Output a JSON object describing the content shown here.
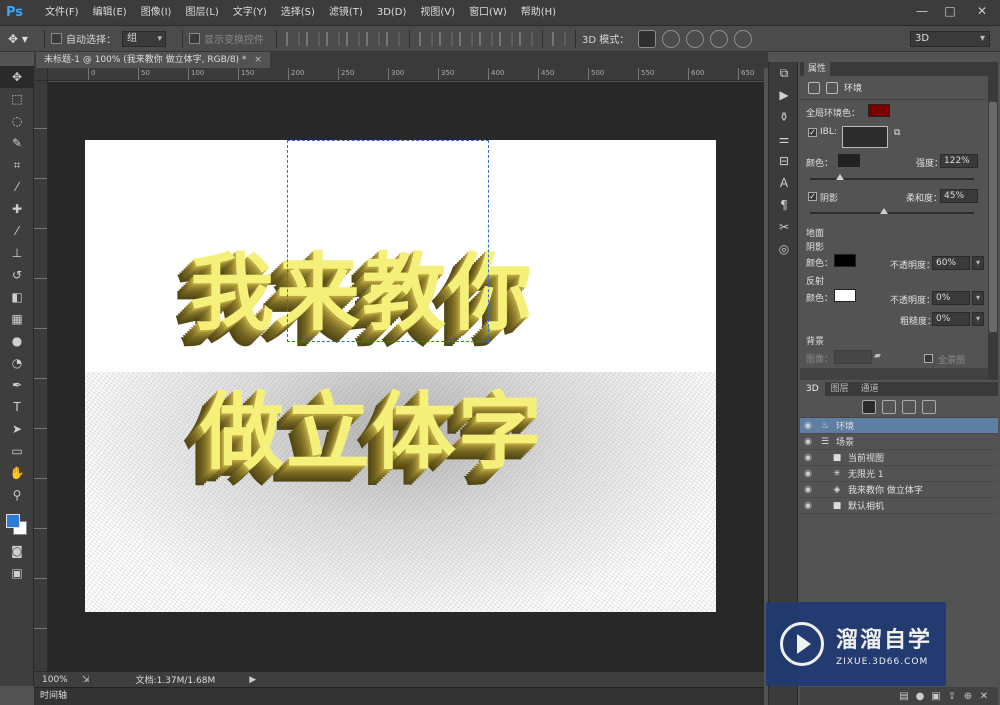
{
  "app": {
    "logo": "Ps",
    "menu": [
      "文件(F)",
      "编辑(E)",
      "图像(I)",
      "图层(L)",
      "文字(Y)",
      "选择(S)",
      "滤镜(T)",
      "3D(D)",
      "视图(V)",
      "窗口(W)",
      "帮助(H)"
    ],
    "window_controls": [
      "—",
      "□",
      "✕"
    ]
  },
  "options_bar": {
    "auto_select_label": "自动选择：",
    "auto_select_value": "组",
    "show_transform_label": "显示变换控件",
    "mode_3d_label": "3D 模式：",
    "workspace_value": "3D"
  },
  "document": {
    "tab_title": "未标题-1 @ 100% (我来教你 做立体字, RGB/8) *",
    "close": "×",
    "ruler_h_ticks": [
      "0",
      "50",
      "100",
      "150",
      "200",
      "250",
      "300",
      "350",
      "400",
      "450",
      "500",
      "550",
      "600",
      "650"
    ],
    "text_line1": "我来教你",
    "text_line2": "做立体字"
  },
  "status_bar": {
    "zoom": "100%",
    "doc_info": "文档:1.37M/1.68M",
    "arrow": "▶"
  },
  "timeline": {
    "label": "时间轴"
  },
  "properties": {
    "tab_label": "属性",
    "header": "环境",
    "global_ambient_label": "全局环境色：",
    "global_ambient_color": "#7a0000",
    "ibl_label": "IBL:",
    "color_label": "颜色：",
    "intensity_label": "强度：",
    "intensity_value": "122%",
    "shadow_label": "阴影",
    "softness_label": "柔和度：",
    "softness_value": "45%",
    "ground_label": "地面",
    "ground_shadow_label": "阴影",
    "ground_color_label": "颜色：",
    "ground_opacity_label": "不透明度：",
    "ground_opacity_value": "60%",
    "reflection_label": "反射",
    "refl_color_label": "颜色：",
    "refl_opacity_label": "不透明度：",
    "refl_opacity_value": "0%",
    "roughness_label": "粗糙度：",
    "roughness_value": "0%",
    "background_label": "背景",
    "image_label": "图像：",
    "panorama_label": "全景图"
  },
  "panel3d": {
    "tabs": [
      "3D",
      "图层",
      "通道"
    ],
    "rows": [
      {
        "label": "环境",
        "icon": "♨",
        "indent": 0,
        "selected": true
      },
      {
        "label": "场景",
        "icon": "☰",
        "indent": 0,
        "selected": false
      },
      {
        "label": "当前视图",
        "icon": "■",
        "indent": 1,
        "selected": false
      },
      {
        "label": "无限光 1",
        "icon": "✳",
        "indent": 1,
        "selected": false
      },
      {
        "label": "我来教你 做立体字",
        "icon": "◈",
        "indent": 1,
        "selected": false
      },
      {
        "label": "默认相机",
        "icon": "■",
        "indent": 1,
        "selected": false
      }
    ]
  },
  "watermark": {
    "title": "溜溜自学",
    "url": "ZIXUE.3D66.COM"
  }
}
